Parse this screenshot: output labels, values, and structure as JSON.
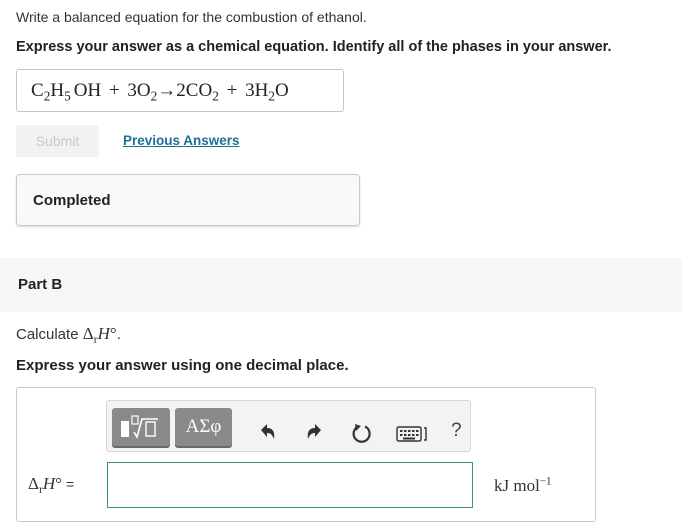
{
  "part_a": {
    "question": "Write a balanced equation for the combustion of ethanol.",
    "instruction": "Express your answer as a chemical equation. Identify all of the phases in your answer.",
    "answer": {
      "ethanol": {
        "C": "C",
        "c_sub": "2",
        "H": "H",
        "h_sub": "5",
        "OH": "OH"
      },
      "plus1": "+",
      "o2": {
        "coef": "3",
        "O": "O",
        "sub": "2"
      },
      "arrow": "→",
      "co2": {
        "coef": "2",
        "C": "CO",
        "sub": "2"
      },
      "plus2": "+",
      "h2o": {
        "coef": "3",
        "H": "H",
        "sub": "2",
        "O": "O"
      }
    },
    "submit_label": "Submit",
    "previous_answers_label": "Previous Answers",
    "status": "Completed"
  },
  "part_b": {
    "title": "Part B",
    "calc_prefix": "Calculate",
    "delta": "Δ",
    "r_sub": "r",
    "h_symbol": "H",
    "degree": "°",
    "period": ".",
    "instruction": "Express your answer using one decimal place.",
    "toolbar": {
      "templates_icon": "templates-icon",
      "greek_label": "ΑΣφ",
      "undo_icon": "undo-icon",
      "redo_icon": "redo-icon",
      "reset_icon": "reset-icon",
      "keyboard_icon": "keyboard-icon",
      "help_label": "?"
    },
    "equals": "=",
    "input_value": "",
    "units": {
      "kJ": "kJ",
      "mol": "mol",
      "exp": "−1"
    }
  },
  "colors": {
    "link": "#1e6f96",
    "toolbar_button": "#8a8a8a",
    "input_border": "#3d8f8a",
    "submit_disabled_text": "#c9c9c9"
  }
}
